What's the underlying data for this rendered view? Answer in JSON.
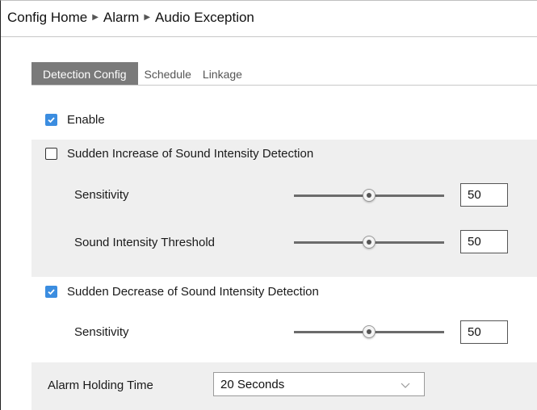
{
  "breadcrumb": {
    "items": [
      "Config Home",
      "Alarm",
      "Audio Exception"
    ]
  },
  "tabs": [
    {
      "label": "Detection Config",
      "active": true
    },
    {
      "label": "Schedule",
      "active": false
    },
    {
      "label": "Linkage",
      "active": false
    }
  ],
  "enable": {
    "label": "Enable",
    "checked": true
  },
  "increase": {
    "label": "Sudden Increase of Sound Intensity Detection",
    "checked": false,
    "sensitivity": {
      "label": "Sensitivity",
      "value": "50",
      "level": 0.5
    },
    "threshold": {
      "label": "Sound Intensity Threshold",
      "value": "50",
      "level": 0.5
    }
  },
  "decrease": {
    "label": "Sudden Decrease of Sound Intensity Detection",
    "checked": true,
    "sensitivity": {
      "label": "Sensitivity",
      "value": "50",
      "level": 0.5
    }
  },
  "holding": {
    "label": "Alarm Holding Time",
    "value": "20 Seconds"
  },
  "icons": {
    "breadcrumb_separator": "triangle-right",
    "dropdown": "chevron-down",
    "checkbox": "check"
  },
  "colors": {
    "accent": "#3b8de0",
    "active_tab": "#7a7a7a",
    "panel_bg": "#efefef"
  }
}
